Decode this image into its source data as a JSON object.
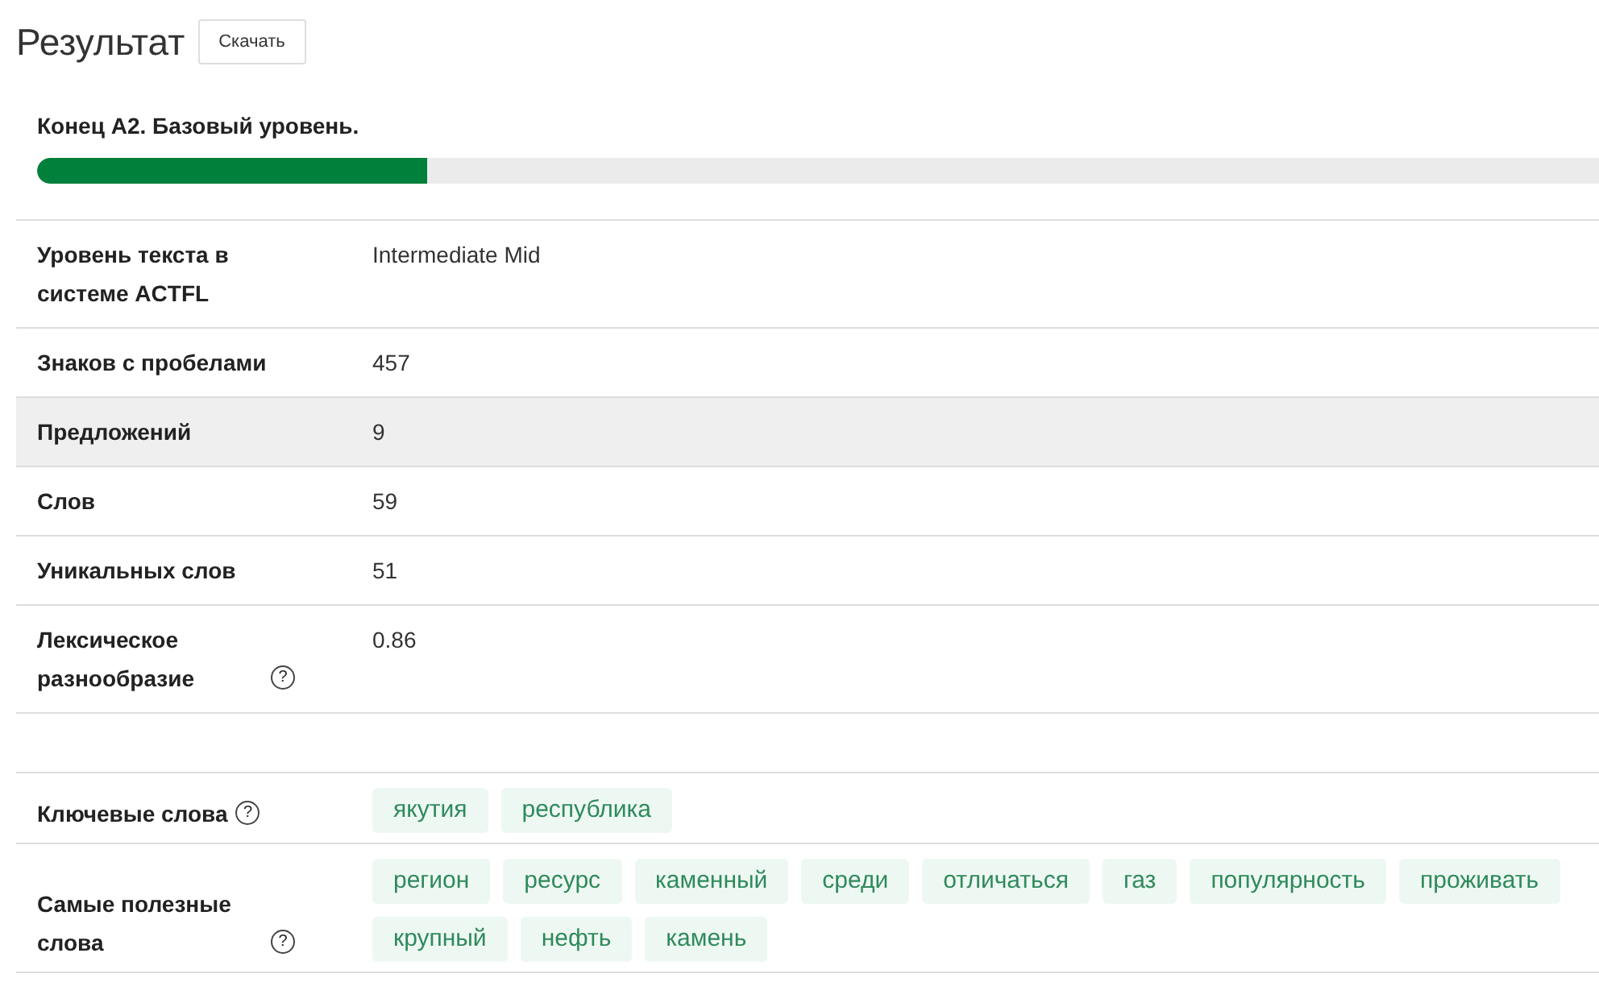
{
  "header": {
    "title": "Результат",
    "download_button": "Скачать"
  },
  "level": {
    "label": "Конец A2. Базовый уровень.",
    "level": 0.25
  },
  "stats": [
    {
      "label": "Уровень текста в системе ACTFL",
      "value": "Intermediate Mid",
      "highlighted": false
    },
    {
      "label": "Знаков с пробелами",
      "value": "457",
      "highlighted": false
    },
    {
      "label": "Предложений",
      "value": "9",
      "highlighted": true
    },
    {
      "label": "Слов",
      "value": "59",
      "highlighted": false
    },
    {
      "label": "Уникальных слов",
      "value": "51",
      "highlighted": false
    },
    {
      "label": "Лексическое разнообразие",
      "help": "?",
      "value": "0.86",
      "highlighted": false
    }
  ],
  "word_groups": [
    {
      "label": "Ключевые слова",
      "help": "?",
      "tags": [
        "якутия",
        "республика"
      ]
    },
    {
      "label": "Самые полезные слова",
      "help": "?",
      "tags": [
        "регион",
        "ресурс",
        "каменный",
        "среди",
        "отличаться",
        "газ",
        "популярность",
        "проживать",
        "крупный",
        "нефть",
        "камень"
      ]
    }
  ]
}
